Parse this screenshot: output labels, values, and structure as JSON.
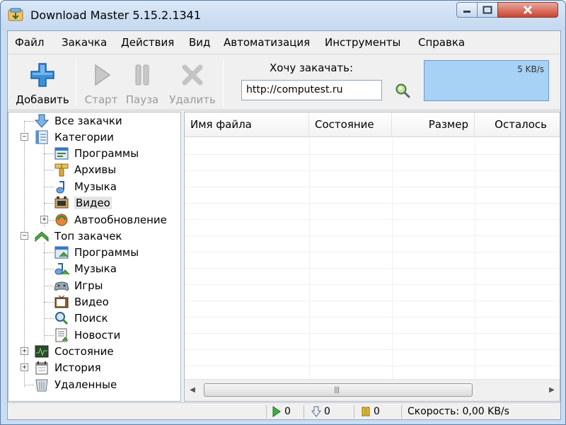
{
  "window": {
    "title": "Download Master 5.15.2.1341"
  },
  "menu": [
    "Файл",
    "Закачка",
    "Действия",
    "Вид",
    "Автоматизация",
    "Инструменты",
    "Справка"
  ],
  "toolbar": {
    "add_label": "Добавить",
    "start_label": "Старт",
    "pause_label": "Пауза",
    "delete_label": "Удалить",
    "url_label": "Хочу закачать:",
    "url_value": "http://computest.ru",
    "speed_text": "5 KB/s"
  },
  "tree": {
    "all": "Все закачки",
    "categories": "Категории",
    "cat_programs": "Программы",
    "cat_archives": "Архивы",
    "cat_music": "Музыка",
    "cat_video": "Видео",
    "cat_autoupdate": "Автообновление",
    "top": "Топ закачек",
    "top_programs": "Программы",
    "top_music": "Музыка",
    "top_games": "Игры",
    "top_video": "Видео",
    "top_search": "Поиск",
    "top_news": "Новости",
    "state": "Состояние",
    "history": "История",
    "deleted": "Удаленные"
  },
  "list": {
    "columns": [
      "Имя файла",
      "Состояние",
      "Размер",
      "Осталось"
    ]
  },
  "status": {
    "active": "0",
    "queued": "0",
    "paused": "0",
    "speed": "Скорость: 0,00 KB/s"
  },
  "colors": {
    "accent": "#3a8fd8",
    "graph_bg": "#a7d1f5",
    "title_bg": "#c9dcf2"
  }
}
